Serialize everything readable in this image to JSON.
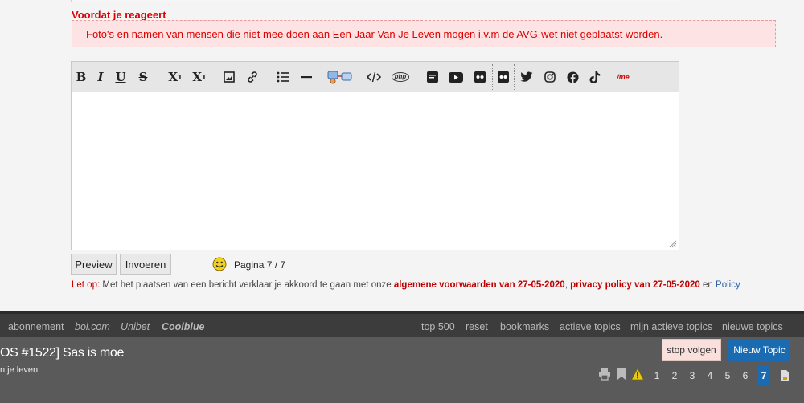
{
  "notice": {
    "title": "Voordat je reageert",
    "text": "Foto's en namen van mensen die niet mee doen aan Een Jaar Van Je Leven mogen i.v.m de AVG-wet niet geplaatst worden."
  },
  "toolbar": {
    "bold": "B",
    "italic": "I",
    "underline": "U",
    "strike": "S",
    "subscript": "X",
    "subscript_mark": "1",
    "superscript": "X",
    "superscript_mark": "1",
    "php": "php",
    "me": "/me"
  },
  "actions": {
    "preview": "Preview",
    "submit": "Invoeren",
    "page_indicator": "Pagina 7 / 7"
  },
  "terms": {
    "prefix": "Let op:",
    "text": " Met het plaatsen van een bericht verklaar je akkoord te gaan met onze ",
    "link1": "algemene voorwaarden van 27-05-2020",
    "comma": ", ",
    "link2": "privacy policy van 27-05-2020",
    "and": " en ",
    "link3": "Policy"
  },
  "nav": {
    "left": [
      "abonnement",
      "bol.com",
      "Unibet",
      "Coolblue"
    ],
    "right": [
      "top 500",
      "reset",
      "bookmarks",
      "actieve topics",
      "mijn actieve topics",
      "nieuwe topics"
    ]
  },
  "topic": {
    "title": "OS #1522] Sas is moe",
    "subtitle": "n je leven",
    "stop_follow": "stop volgen",
    "new_topic": "Nieuw Topic"
  },
  "pagination": {
    "pages": [
      "1",
      "2",
      "3",
      "4",
      "5",
      "6",
      "7"
    ],
    "current": "7"
  },
  "colors": {
    "accent_blue": "#1b6bb3",
    "alert_red": "#e00000",
    "navbar": "#3c3c3c",
    "topicbar": "#5a5a5a"
  }
}
